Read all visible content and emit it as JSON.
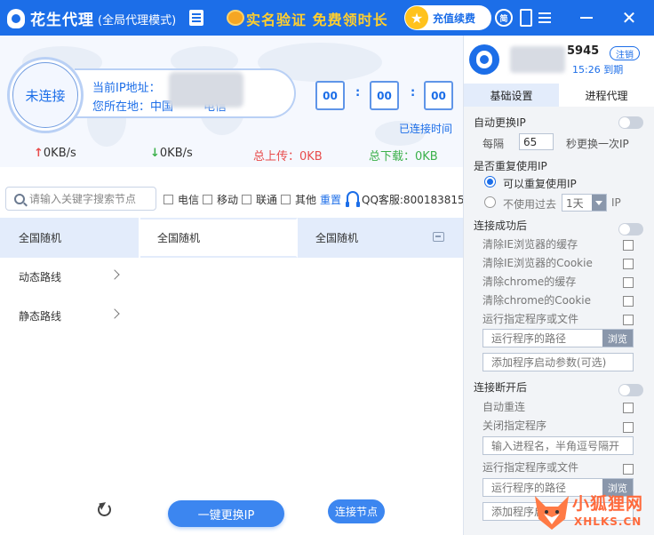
{
  "titlebar": {
    "app_name": "花生代理",
    "mode": "(全局代理模式)",
    "promo": "实名验证 免费领时长",
    "recharge_label": "充值续费"
  },
  "status": {
    "connection_label": "未连接",
    "ip_label": "当前IP地址：",
    "location_label": "您所在地：中国",
    "location_isp": "电信",
    "timer_hours": "00",
    "timer_minutes": "00",
    "timer_seconds": "00",
    "timer_sep": ":",
    "connected_time_label": "已连接时间",
    "upload_speed": "0KB/s",
    "download_speed": "0KB/s",
    "total_upload": "总上传：0KB",
    "total_download": "总下载：0KB"
  },
  "filter": {
    "search_placeholder": "请输入关键字搜索节点",
    "options": [
      "电信",
      "移动",
      "联通",
      "其他"
    ],
    "reset_label": "重置",
    "qq_label": "QQ客服:800183815"
  },
  "nodes": {
    "columns": [
      "全国随机",
      "全国随机",
      "全国随机"
    ],
    "nav_items": [
      "动态路线",
      "静态路线"
    ]
  },
  "bottom": {
    "change_ip_label": "一键更换IP",
    "connect_node_label": "连接节点"
  },
  "user": {
    "id_suffix": "5945",
    "logout_label": "注销",
    "expire_text": "15:26 到期"
  },
  "tabs": [
    "基础设置",
    "进程代理"
  ],
  "settings": {
    "auto_change_ip": "自动更换IP",
    "every_label": "每隔",
    "interval_value": "65",
    "interval_suffix": "秒更换一次IP",
    "reuse_title": "是否重复使用IP",
    "reuse_yes": "可以重复使用IP",
    "reuse_no_prefix": "不使用过去",
    "reuse_no_days": "1天",
    "reuse_no_suffix": "IP",
    "after_connect_title": "连接成功后",
    "after_connect_items": [
      "清除IE浏览器的缓存",
      "清除IE浏览器的Cookie",
      "清除chrome的缓存",
      "清除chrome的Cookie",
      "运行指定程序或文件"
    ],
    "program_path_placeholder": "运行程序的路径",
    "browse_label": "浏览",
    "program_args_placeholder": "添加程序启动参数(可选)",
    "after_disconnect_title": "连接断开后",
    "auto_reconnect": "自动重连",
    "close_program": "关闭指定程序",
    "process_name_placeholder": "输入进程名，半角逗号隔开",
    "run_program": "运行指定程序或文件",
    "program_path_placeholder_2": "运行程序的路径",
    "browse_label_2": "浏览",
    "program_args_placeholder_2": "添加程序启"
  },
  "watermark": {
    "text": "小狐狸网",
    "sub": "XHLKS.CN"
  },
  "colors": {
    "brand_blue": "#1c6ee8",
    "promo_yellow": "#ffcf2e",
    "upload_red": "#e84c4c",
    "download_green": "#3bb04a"
  }
}
